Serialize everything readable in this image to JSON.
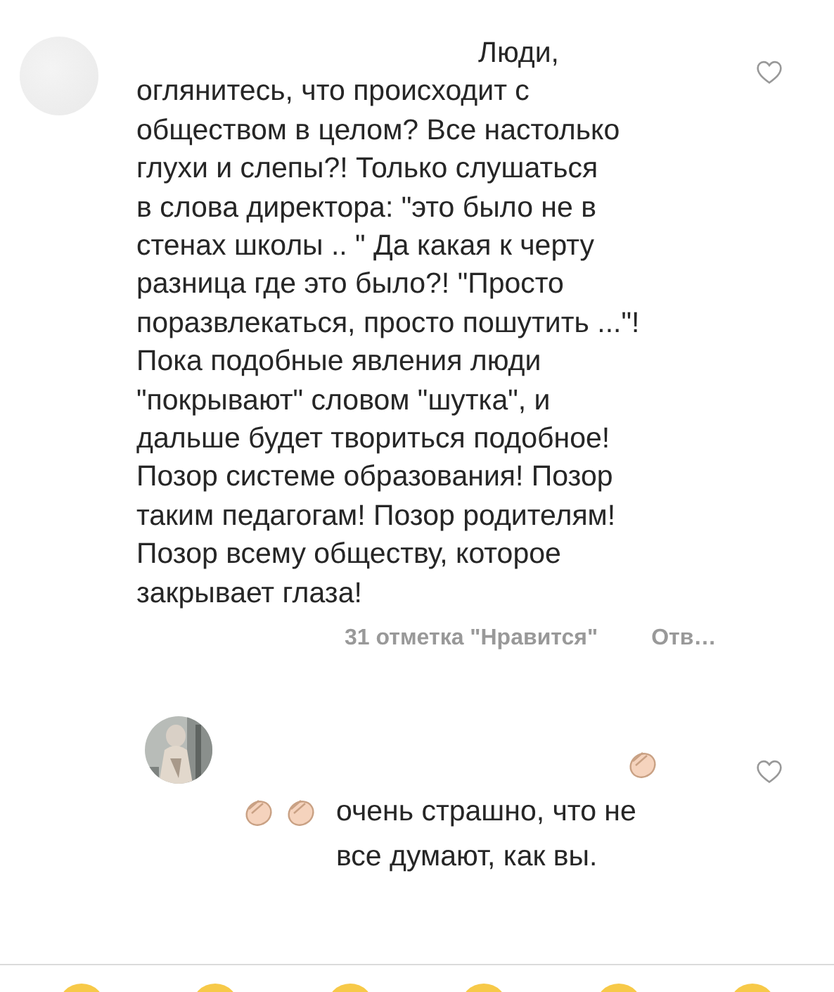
{
  "comments": [
    {
      "kind": "text",
      "liked": false,
      "lines": [
        "Люди,",
        "оглянитесь, что происходит с",
        "обществом в целом? Все настолько",
        "глухи и слепы?! Только слушаться",
        "в слова директора: \"это было не в",
        "стенах школы .. \" Да какая к черту",
        "разница где это было?! \"Просто",
        "поразвлекаться, просто пошутить ...\"!",
        "Пока подобные явления люди",
        "\"покрывают\" словом \"шутка\", и",
        "дальше будет твориться подобное!",
        "Позор системе образования! Позор",
        "таким педагогам! Позор родителям!",
        "Позор всему обществу, которое",
        "закрывает глаза!"
      ],
      "likes": "31 отметка \"Нравится\"",
      "reply": "Отв…"
    },
    {
      "kind": "claps",
      "liked": false,
      "lines": [
        "очень страшно, что не",
        "все думают, как вы."
      ]
    }
  ]
}
